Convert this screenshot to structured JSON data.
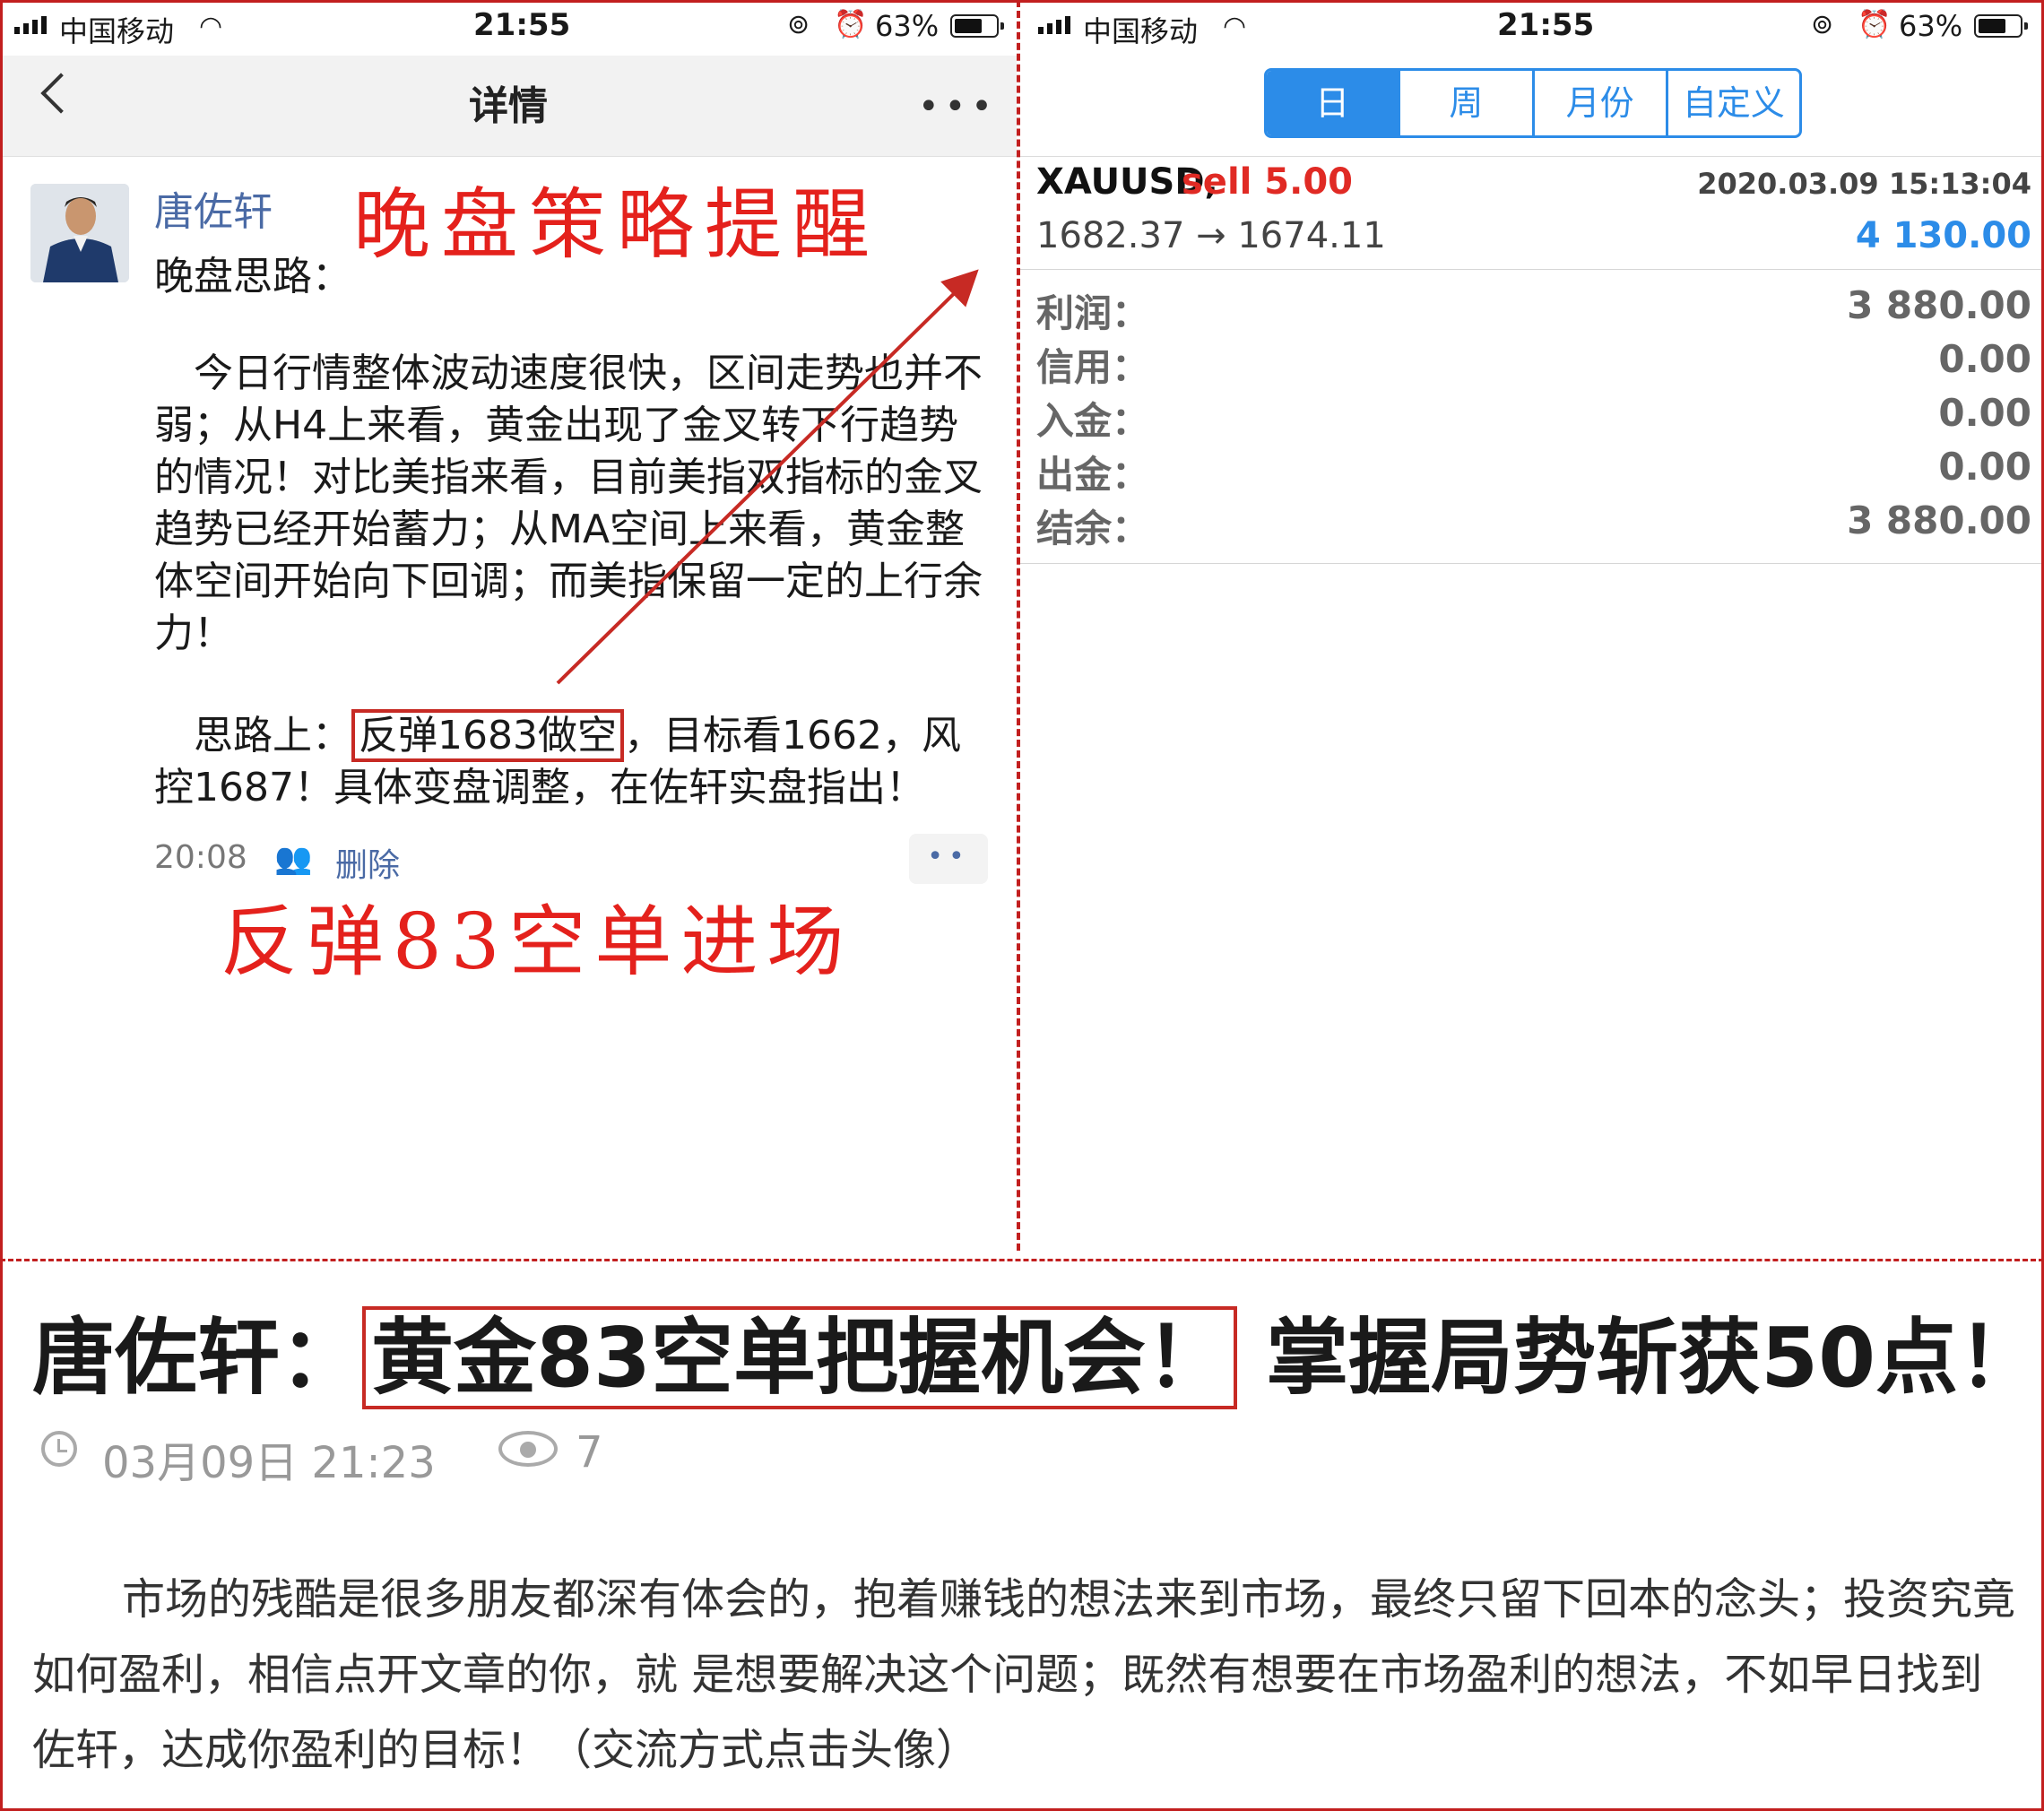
{
  "left_status": {
    "carrier": "中国移动",
    "time": "21:55",
    "battery": "63%"
  },
  "right_status": {
    "carrier": "中国移动",
    "time": "21:55",
    "battery": "63%"
  },
  "left_nav": {
    "title": "详情",
    "more": "•••"
  },
  "post": {
    "author": "唐佐轩",
    "intro": "晚盘思路：",
    "body": "今日行情整体波动速度很快，区间走势也并不弱；从H4上来看，黄金出现了金叉转下行趋势的情况！对比美指来看，目前美指双指标的金叉趋势已经开始蓄力；从MA空间上来看，黄金整体空间开始向下回调；而美指保留一定的上行余力！",
    "plan_prefix": "思路上：",
    "plan_boxed": "反弹1683做空",
    "plan_suffix": "，目标看1662，风",
    "plan_line2": "控1687！具体变盘调整，在佐轩实盘指出！",
    "time": "20:08",
    "delete": "删除",
    "comment": "••"
  },
  "annotations": {
    "heading": "晚盘策略提醒",
    "footer": "反弹83空单进场"
  },
  "right_tabs": [
    "日",
    "周",
    "月份",
    "自定义"
  ],
  "trade": {
    "symbol": "XAUUSD,",
    "side": "sell 5.00",
    "time": "2020.03.09 15:13:04",
    "price": "1682.37 → 1674.11",
    "profit": "4 130.00"
  },
  "summary": [
    {
      "label": "利润：",
      "value": "3 880.00"
    },
    {
      "label": "信用：",
      "value": "0.00"
    },
    {
      "label": "入金：",
      "value": "0.00"
    },
    {
      "label": "出金：",
      "value": "0.00"
    },
    {
      "label": "结余：",
      "value": "3 880.00"
    }
  ],
  "article": {
    "title_prefix": "唐佐轩：",
    "title_boxed": "黄金83空单把握机会！",
    "title_suffix": "掌握局势斩获50点！",
    "date": "03月09日 21:23",
    "views": "7",
    "body": "市场的残酷是很多朋友都深有体会的，抱着赚钱的想法来到市场，最终只留下回本的念头；投资究竟如何盈利，相信点开文章的你，就 是想要解决这个问题；既然有想要在市场盈利的想法，不如早日找到佐轩，达成你盈利的目标！（交流方式点击头像）"
  },
  "colors": {
    "annotation_red": "#e4211c",
    "accent_blue": "#2c8ce8",
    "sell_red": "#e02a24",
    "link_blue": "#4a6aa5"
  }
}
